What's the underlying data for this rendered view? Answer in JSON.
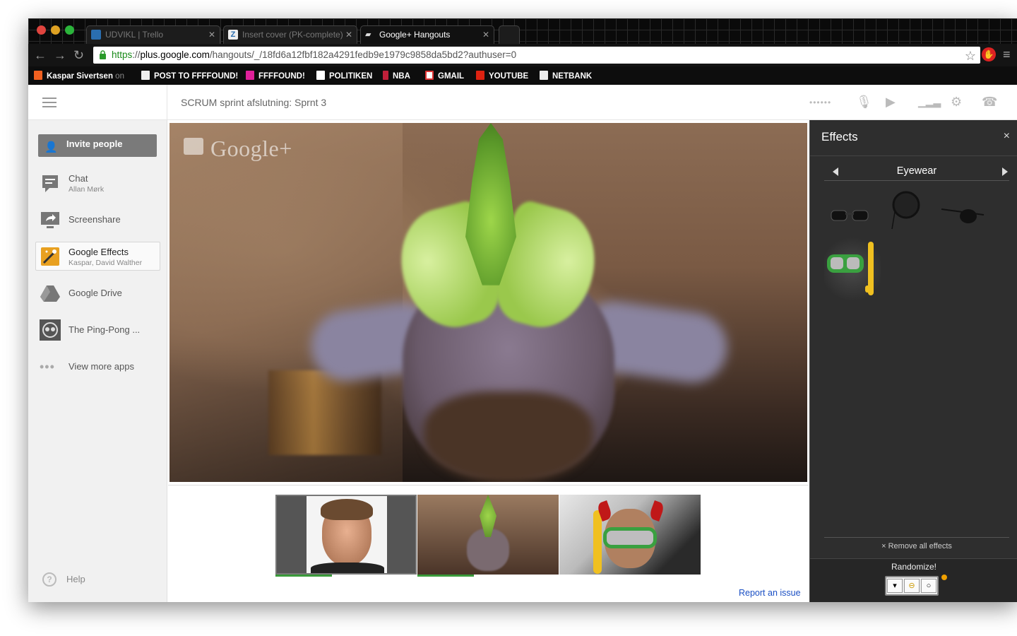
{
  "window": {
    "tabs": [
      {
        "title": "UDVIKL | Trello",
        "icon": "trello-icon",
        "active": false
      },
      {
        "title": "Insert cover (PK-complete)",
        "icon": "zotero-icon",
        "active": false
      },
      {
        "title": "Google+ Hangouts",
        "icon": "hangouts-icon",
        "active": true
      }
    ],
    "url": {
      "scheme": "https",
      "sep": "://",
      "domain": "plus.google.com",
      "path": "/hangouts/_/18fd6a12fbf182a4291fedb9e1979c9858da5bd2?authuser=0"
    },
    "bookmarks": [
      {
        "label": "Kaspar Sivertsen",
        "extra": "on"
      },
      {
        "label": "POST TO FFFFOUND!"
      },
      {
        "label": "FFFFOUND!"
      },
      {
        "label": "POLITIKEN"
      },
      {
        "label": "NBA"
      },
      {
        "label": "GMAIL"
      },
      {
        "label": "YOUTUBE"
      },
      {
        "label": "NETBANK"
      }
    ]
  },
  "header": {
    "title": "SCRUM sprint afslutning: Sprnt 3"
  },
  "sidebar": {
    "invite_label": "Invite people",
    "apps": [
      {
        "title": "Chat",
        "subtitle": "Allan Mørk"
      },
      {
        "title": "Screenshare",
        "subtitle": ""
      },
      {
        "title": "Google Effects",
        "subtitle": "Kaspar, David Walther"
      },
      {
        "title": "Google Drive",
        "subtitle": ""
      },
      {
        "title": "The Ping-Pong ...",
        "subtitle": ""
      },
      {
        "title": "View more apps",
        "subtitle": ""
      }
    ],
    "help_label": "Help"
  },
  "video": {
    "brand": "Google+"
  },
  "report_label": "Report an issue",
  "effects": {
    "title": "Effects",
    "close": "×",
    "category": "Eyewear",
    "items": [
      "sunglasses",
      "monocle",
      "eyepatch",
      "snorkel-mask"
    ],
    "remove_all": "× Remove all effects",
    "randomize": "Randomize!"
  },
  "colors": {
    "accent_link": "#1a4fc4",
    "speaking": "#3a9a3a",
    "panel": "#2e2e2e"
  }
}
